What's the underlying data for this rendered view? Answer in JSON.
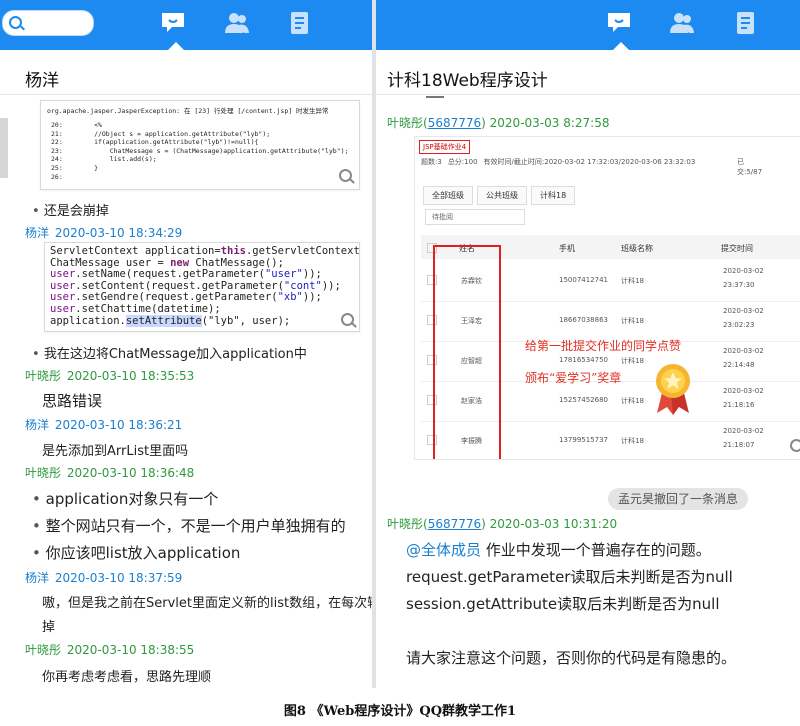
{
  "left": {
    "title": "杨洋",
    "code1": {
      "error": "org.apache.jasper.JasperException: 在 [23] 行处理 [/content.jsp] 时发生异常",
      "lines": [
        {
          "n": "20:",
          "t": "<%"
        },
        {
          "n": "21:",
          "t": "//Object s = application.getAttribute(\"lyb\");"
        },
        {
          "n": "22:",
          "t": "if(application.getAttribute(\"lyb\")!=null){"
        },
        {
          "n": "23:",
          "t": "    ChatMessage s = (ChatMessage)application.getAttribute(\"lyb\");"
        },
        {
          "n": "24:",
          "t": "    list.add(s);"
        },
        {
          "n": "25:",
          "t": "}"
        },
        {
          "n": "26:",
          "t": ""
        }
      ]
    },
    "messages": [
      {
        "text": "还是会崩掉"
      },
      {
        "name": "杨洋",
        "date": "2020-03-10 18:34:29"
      },
      {
        "text": "我在这边将ChatMessage加入application中"
      },
      {
        "name": "叶晓彤",
        "date": "2020-03-10 18:35:53"
      },
      {
        "text": "思路错误"
      },
      {
        "name": "杨洋",
        "date": "2020-03-10 18:36:21"
      },
      {
        "text": "是先添加到ArrList里面吗"
      },
      {
        "name": "叶晓彤",
        "date": "2020-03-10 18:36:48"
      },
      {
        "text": "application对象只有一个"
      },
      {
        "text": "整个网站只有一个，不是一个用户单独拥有的"
      },
      {
        "text": "你应该吧list放入application"
      },
      {
        "name": "杨洋",
        "date": "2020-03-10 18:37:59"
      },
      {
        "text": "嗷，但是我之前在Servlet里面定义新的list数组，在每次输"
      },
      {
        "text": "掉"
      },
      {
        "name": "叶晓彤",
        "date": "2020-03-10 18:38:55"
      },
      {
        "text": "你再考虑考虑看，思路先理顺"
      }
    ],
    "code2": {
      "l1a": "ServletContext application=",
      "l1b": "this",
      "l1c": ".getServletContext();",
      "l2a": "ChatMessage user = ",
      "l2b": "new",
      "l2c": " ChatMessage();",
      "l3a": "user",
      "l3b": ".setName(request.getParameter(",
      "l3c": "\"user\"",
      "l3d": "));",
      "l4a": "user",
      "l4b": ".setContent(request.getParameter(",
      "l4c": "\"cont\"",
      "l4d": "));",
      "l5a": "user",
      "l5b": ".setGendre(request.getParameter(",
      "l5c": "\"xb\"",
      "l5d": "));",
      "l6a": "user",
      "l6b": ".setChattime(datetime);",
      "l7a": "application.",
      "l7b": "setAttribute",
      "l7c": "(\"lyb\", user);"
    }
  },
  "right": {
    "title": "计科18Web程序设计",
    "msg1": {
      "name": "叶晓彤",
      "qq": "5687776",
      "date": "2020-03-03 8:27:58"
    },
    "shot": {
      "course": "JSP基础作业4",
      "meta": [
        "题数:3",
        "总分:100",
        "有效时间/截止时间:2020-03-02 17:32:03/2020-03-06 23:32:03",
        "已交:5/87"
      ],
      "tabs": [
        "全部班级",
        "公共班级",
        "计科18"
      ],
      "select": "待批阅",
      "headers": [
        "姓名",
        "手机",
        "班级名称",
        "提交时间"
      ],
      "rows": [
        {
          "name": "苏霖钦",
          "phone": "15007412741",
          "cls": "计科18",
          "date": "2020-03-02",
          "time": "23:37:30"
        },
        {
          "name": "王泽宏",
          "phone": "18667038863",
          "cls": "计科18",
          "date": "2020-03-02",
          "time": "23:02:23"
        },
        {
          "name": "应智超",
          "phone": "17816534750",
          "cls": "计科18",
          "date": "2020-03-02",
          "time": "22:14:48"
        },
        {
          "name": "赵家浩",
          "phone": "15257452680",
          "cls": "计科18",
          "date": "2020-03-02",
          "time": "21:18:16"
        },
        {
          "name": "李振腾",
          "phone": "13799515737",
          "cls": "计科18",
          "date": "2020-03-02",
          "time": "21:18:07"
        }
      ],
      "note1": "给第一批提交作业的同学点赞",
      "note2": "颁布“爱学习”奖章"
    },
    "recall": "孟元昊撤回了一条消息",
    "msg2": {
      "name": "叶晓彤",
      "qq": "5687776",
      "date": "2020-03-03 10:31:20"
    },
    "mention": "@全体成员",
    "lines": [
      "作业中发现一个普遍存在的问题。",
      "request.getParameter读取后未判断是否为null",
      "session.getAttribute读取后未判断是否为null",
      "请大家注意这个问题，否则你的代码是有隐患的。"
    ]
  },
  "caption": "图8 《Web程序设计》QQ群教学工作1",
  "colors": {
    "topbar": "#1c8af0",
    "name_blue": "#1a7fd0",
    "name_green": "#2f9a3e",
    "red": "#e02020"
  },
  "icons": [
    "search-icon",
    "chat-icon",
    "contacts-icon",
    "document-icon",
    "zoom-icon",
    "medal-icon"
  ]
}
